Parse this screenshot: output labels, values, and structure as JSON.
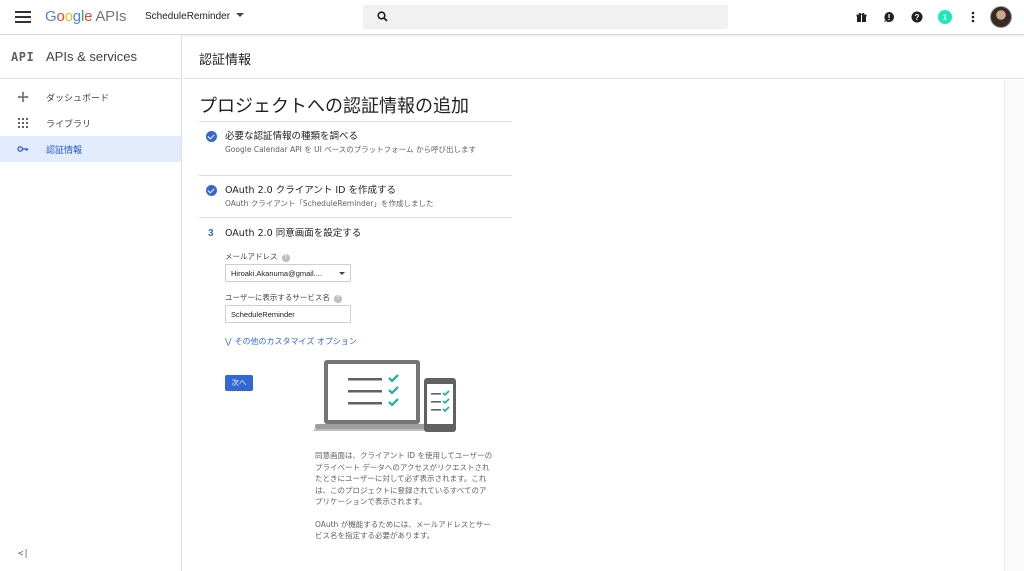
{
  "topbar": {
    "logo_google": "Google",
    "logo_apis": "APIs",
    "project_name": "ScheduleReminder",
    "notification_count": "1"
  },
  "sidebar": {
    "mark": "API",
    "title": "APIs & services",
    "items": [
      {
        "label": "ダッシュボード",
        "icon": "dashboard-icon",
        "active": false
      },
      {
        "label": "ライブラリ",
        "icon": "library-icon",
        "active": false
      },
      {
        "label": "認証情報",
        "icon": "key-icon",
        "active": true
      }
    ],
    "collapse_label": "<|"
  },
  "header": {
    "title": "認証情報"
  },
  "page": {
    "title": "プロジェクトへの認証情報の追加",
    "steps": [
      {
        "status": "done",
        "title": "必要な認証情報の種類を調べる",
        "desc": "Google Calendar API を UI ベースのプラットフォーム から呼び出します"
      },
      {
        "status": "done",
        "title": "OAuth 2.0 クライアント ID を作成する",
        "desc": "OAuth クライアント「ScheduleReminder」を作成しました"
      },
      {
        "status": "current",
        "number": "3",
        "title": "OAuth 2.0 同意画面を設定する"
      }
    ],
    "form": {
      "email_label": "メールアドレス",
      "email_value": "Hiroaki.Akanuma@gmail....",
      "service_label": "ユーザーに表示するサービス名",
      "service_value": "ScheduleReminder",
      "more_options": "その他のカスタマイズ オプション",
      "next_button": "次へ"
    },
    "info": {
      "paragraph1": "同意画面は、クライアント ID を使用してユーザーのプライベート データへのアクセスがリクエストされたときにユーザーに対して必ず表示されます。これは、このプロジェクトに登録されているすべてのアプリケーションで表示されます。",
      "paragraph2": "OAuth が機能するためには、メールアドレスとサービス名を指定する必要があります。"
    }
  },
  "colors": {
    "accent": "#3367d6",
    "active_bg": "#e3ecfc",
    "check_green": "#1bae9f"
  }
}
